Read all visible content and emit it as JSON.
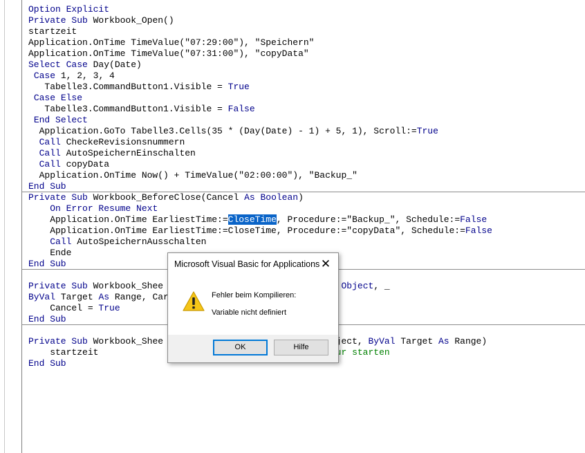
{
  "code": {
    "lines": [
      [
        {
          "t": "Option Explicit",
          "c": "kw"
        }
      ],
      [
        {
          "t": "Private Sub",
          "c": "kw"
        },
        {
          "t": " Workbook_Open()"
        }
      ],
      [
        {
          "t": "startzeit"
        }
      ],
      [
        {
          "t": "Application.OnTime TimeValue(\"07:29:00\"), \"Speichern\""
        }
      ],
      [
        {
          "t": "Application.OnTime TimeValue(\"07:31:00\"), \"copyData\""
        }
      ],
      [
        {
          "t": "Select Case",
          "c": "kw"
        },
        {
          "t": " Day(Date)"
        }
      ],
      [
        {
          "t": " "
        },
        {
          "t": "Case",
          "c": "kw"
        },
        {
          "t": " 1, 2, 3, 4"
        }
      ],
      [
        {
          "t": "   Tabelle3.CommandButton1.Visible = "
        },
        {
          "t": "True",
          "c": "kw"
        }
      ],
      [
        {
          "t": " "
        },
        {
          "t": "Case Else",
          "c": "kw"
        }
      ],
      [
        {
          "t": "   Tabelle3.CommandButton1.Visible = "
        },
        {
          "t": "False",
          "c": "kw"
        }
      ],
      [
        {
          "t": " "
        },
        {
          "t": "End Select",
          "c": "kw"
        }
      ],
      [
        {
          "t": "  Application.GoTo Tabelle3.Cells(35 * (Day(Date) - 1) + 5, 1), Scroll:="
        },
        {
          "t": "True",
          "c": "kw"
        }
      ],
      [
        {
          "t": "  "
        },
        {
          "t": "Call",
          "c": "kw"
        },
        {
          "t": " CheckeRevisionsnummern"
        }
      ],
      [
        {
          "t": "  "
        },
        {
          "t": "Call",
          "c": "kw"
        },
        {
          "t": " AutoSpeichernEinschalten"
        }
      ],
      [
        {
          "t": "  "
        },
        {
          "t": "Call",
          "c": "kw"
        },
        {
          "t": " copyData"
        }
      ],
      [
        {
          "t": "  Application.OnTime Now() + TimeValue(\"02:00:00\"), \"Backup_\""
        }
      ],
      [
        {
          "t": "End Sub",
          "c": "kw"
        }
      ],
      [
        {
          "t": "Private Sub",
          "c": "kw"
        },
        {
          "t": " Workbook_BeforeClose(Cancel "
        },
        {
          "t": "As Boolean",
          "c": "kw"
        },
        {
          "t": ")"
        }
      ],
      [
        {
          "t": "    "
        },
        {
          "t": "On Error Resume Next",
          "c": "kw"
        }
      ],
      [
        {
          "t": "    Application.OnTime EarliestTime:="
        },
        {
          "t": "CloseTime",
          "c": "sel"
        },
        {
          "t": ", Procedure:=\"Backup_\", Schedule:="
        },
        {
          "t": "False",
          "c": "kw"
        }
      ],
      [
        {
          "t": "    Application.OnTime EarliestTime:=CloseTime, Procedure:=\"copyData\", Schedule:="
        },
        {
          "t": "False",
          "c": "kw"
        }
      ],
      [
        {
          "t": "    "
        },
        {
          "t": "Call",
          "c": "kw"
        },
        {
          "t": " AutoSpeichernAusschalten"
        }
      ],
      [
        {
          "t": "    Ende"
        }
      ],
      [
        {
          "t": "End Sub",
          "c": "kw"
        }
      ],
      [
        {
          "t": ""
        }
      ],
      [
        {
          "t": "Private Sub",
          "c": "kw"
        },
        {
          "t": " Workbook_Shee                                 "
        },
        {
          "t": "Object",
          "c": "kw"
        },
        {
          "t": ", _"
        }
      ],
      [
        {
          "t": "ByVal",
          "c": "kw"
        },
        {
          "t": " Target "
        },
        {
          "t": "As",
          "c": "kw"
        },
        {
          "t": " Range, Car"
        }
      ],
      [
        {
          "t": "    Cancel = "
        },
        {
          "t": "True",
          "c": "kw"
        }
      ],
      [
        {
          "t": "End Sub",
          "c": "kw"
        }
      ],
      [
        {
          "t": ""
        }
      ],
      [
        {
          "t": "Private Sub",
          "c": "kw"
        },
        {
          "t": " Workbook_Shee                                "
        },
        {
          "t": "ject, "
        },
        {
          "t": "ByVal",
          "c": "kw"
        },
        {
          "t": " Target "
        },
        {
          "t": "As",
          "c": "kw"
        },
        {
          "t": " Range)"
        }
      ],
      [
        {
          "t": "    startzeit                                        "
        },
        {
          "t": "ozedur starten",
          "c": "cmt"
        }
      ],
      [
        {
          "t": "End Sub",
          "c": "kw"
        }
      ]
    ]
  },
  "dialog": {
    "title": "Microsoft Visual Basic for Applications",
    "close_label": "✕",
    "message_title": "Fehler beim Kompilieren:",
    "message_detail": "Variable nicht definiert",
    "ok_label": "OK",
    "help_label": "Hilfe"
  },
  "colors": {
    "keyword": "#00008b",
    "comment": "#008000",
    "selection": "#0a64c8",
    "warning": "#f5c518"
  }
}
